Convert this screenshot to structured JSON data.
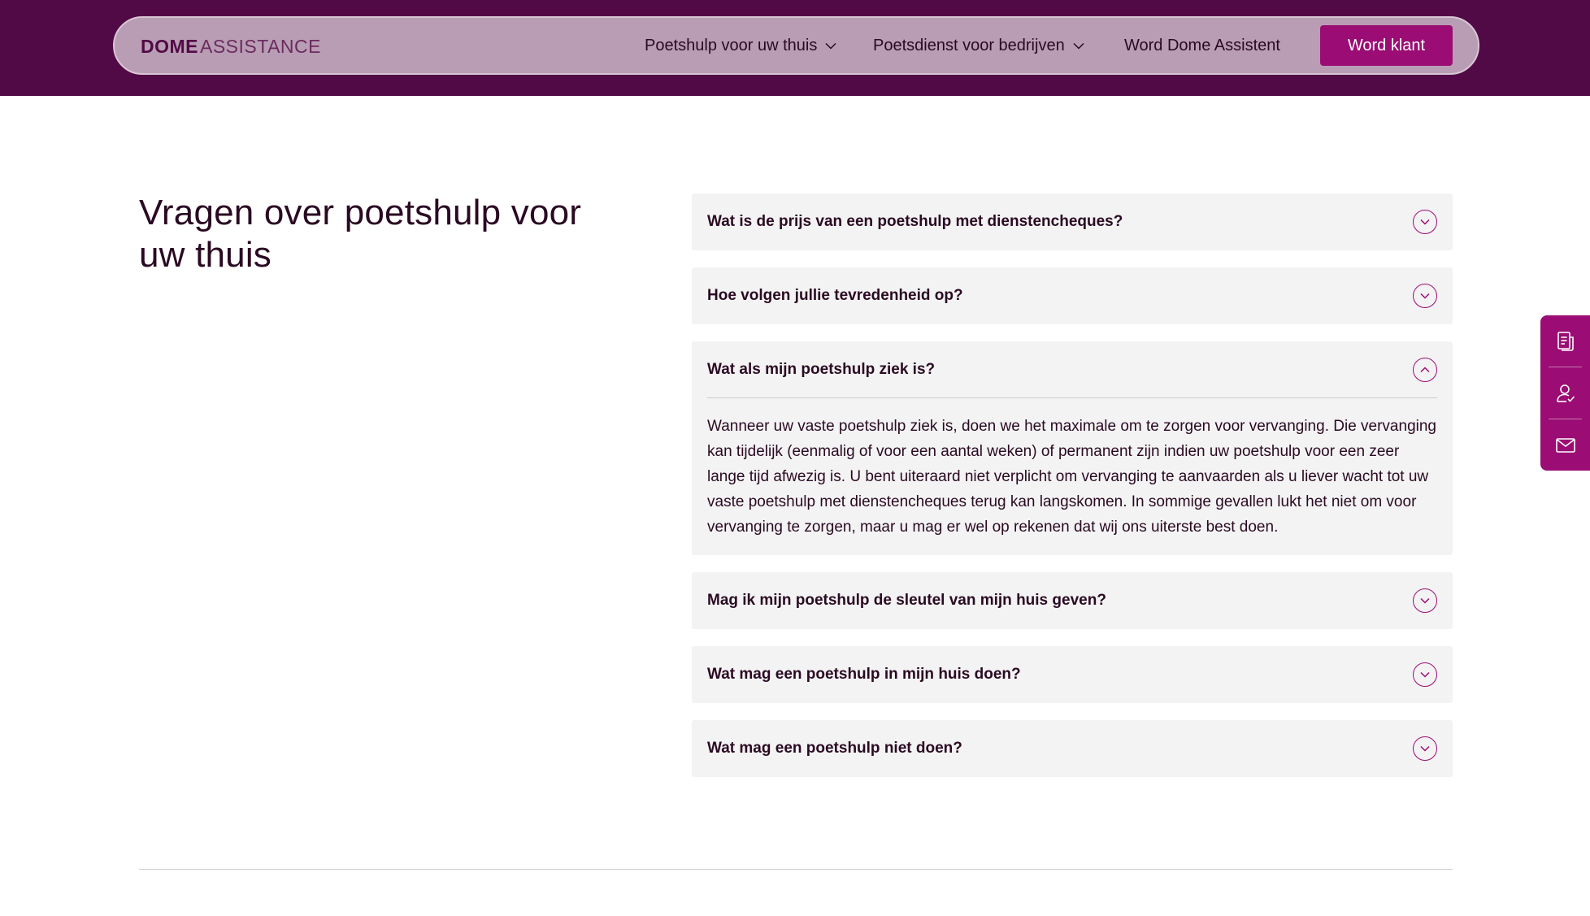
{
  "header": {
    "logo": {
      "bold": "DOME",
      "light": "ASSISTANCE"
    },
    "nav": [
      {
        "label": "Poetshulp voor uw thuis",
        "has_dropdown": true
      },
      {
        "label": "Poetsdienst voor bedrijven",
        "has_dropdown": true
      },
      {
        "label": "Word Dome Assistent",
        "has_dropdown": false
      }
    ],
    "cta_label": "Word klant"
  },
  "faq": {
    "title": "Vragen over poetshulp voor uw thuis",
    "items": [
      {
        "question": "Wat is de prijs van een poetshulp met dienstencheques?",
        "open": false
      },
      {
        "question": "Hoe volgen jullie tevredenheid op?",
        "open": false
      },
      {
        "question": "Wat als mijn poetshulp ziek is?",
        "open": true,
        "answer": "Wanneer uw vaste poetshulp ziek is, doen we het maximale om te zorgen voor vervanging. Die vervanging kan tijdelijk (eenmalig of voor een aantal weken) of permanent zijn indien uw poetshulp voor een zeer lange tijd afwezig is. U bent uiteraard niet verplicht om vervanging te aanvaarden als u liever wacht tot uw vaste poetshulp met dienstencheques terug kan langskomen. In sommige gevallen lukt het niet om voor vervanging te zorgen, maar u mag er wel op rekenen dat wij ons uiterste best doen."
      },
      {
        "question": "Mag ik mijn poetshulp de sleutel van mijn huis geven?",
        "open": false
      },
      {
        "question": "Wat mag een poetshulp in mijn huis doen?",
        "open": false
      },
      {
        "question": "Wat mag een poetshulp niet doen?",
        "open": false
      }
    ]
  },
  "side_tab": {
    "icons": [
      "document-icon",
      "user-check-icon",
      "mail-icon"
    ]
  },
  "colors": {
    "header_bg": "#520a47",
    "nav_pill_bg": "#b99db4",
    "accent": "#9b0c74",
    "faq_item_bg": "#f3f3f3",
    "text": "#2a0a22"
  }
}
